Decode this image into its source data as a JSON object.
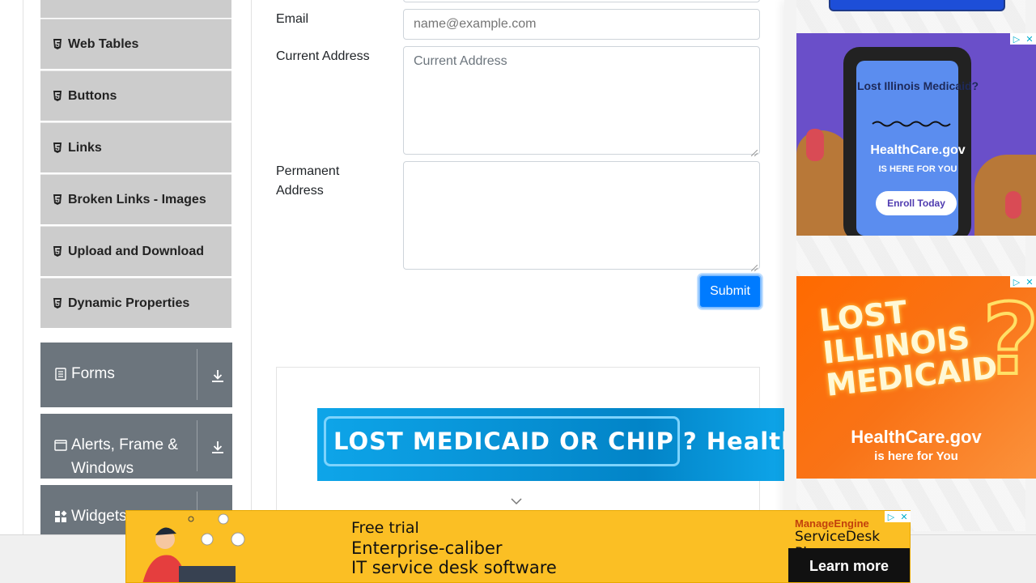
{
  "sidebar": {
    "elements_items": [
      {
        "label": "Web Tables"
      },
      {
        "label": "Buttons"
      },
      {
        "label": "Links"
      },
      {
        "label": "Broken Links - Images"
      },
      {
        "label": "Upload and Download"
      },
      {
        "label": "Dynamic Properties"
      }
    ],
    "groups": [
      {
        "label": "Forms"
      },
      {
        "label": "Alerts, Frame &",
        "label2": "Windows"
      },
      {
        "label": "Widgets"
      }
    ]
  },
  "form": {
    "email_label": "Email",
    "email_placeholder": "name@example.com",
    "current_address_label": "Current Address",
    "current_address_placeholder": "Current Address",
    "permanent_address_label_line1": "Permanent",
    "permanent_address_label_line2": "Address",
    "submit_label": "Submit"
  },
  "ads": {
    "wide_banner_text": "LOST MEDICAID OR CHIP ? HealthCare",
    "right_ad1": {
      "headline": "Lost Illinois Medicaid?",
      "brand": "HealthCare.gov",
      "tagline": "IS HERE FOR YOU",
      "cta": "Enroll Today"
    },
    "right_ad2": {
      "headline_line1": "LOST",
      "headline_line2": "ILLINOIS",
      "headline_line3": "MEDICAID",
      "brand": "HealthCare.gov",
      "tagline": "is here for You"
    },
    "bottom_ad": {
      "line1": "Free trial",
      "line2": "Enterprise-caliber",
      "line3": "IT service desk software",
      "vendor": "ManageEngine",
      "product": "ServiceDesk Plus",
      "cta": "Learn more"
    }
  },
  "colors": {
    "primary": "#007bff",
    "sidebar_item_bg": "#cccccc",
    "group_bg": "#6c757d"
  }
}
